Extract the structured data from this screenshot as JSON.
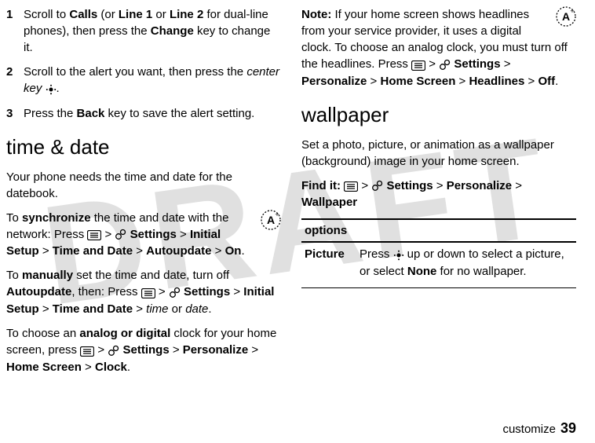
{
  "watermark": "DRAFT",
  "left": {
    "step1_num": "1",
    "step1_a": "Scroll to ",
    "step1_calls": "Calls",
    "step1_b": " (or ",
    "step1_line1": "Line 1",
    "step1_c": " or ",
    "step1_line2": "Line 2",
    "step1_d": " for dual-line phones), then press the ",
    "step1_change": "Change",
    "step1_e": " key to change it.",
    "step2_num": "2",
    "step2_a": "Scroll to the alert you want, then press the ",
    "step2_ck": "center key",
    "step2_b": ".",
    "step3_num": "3",
    "step3_a": "Press the ",
    "step3_back": "Back",
    "step3_b": " key to save the alert setting.",
    "h_timedate": "time & date",
    "td_intro": "Your phone needs the time and date for the datebook.",
    "sync_a": "To ",
    "sync_bold": "synchronize",
    "sync_b": " the time and date with the network: Press ",
    "sync_gt1": " > ",
    "sync_settings": "Settings",
    "sync_gt2": " > ",
    "sync_initial": "Initial Setup",
    "sync_gt3": " > ",
    "sync_td": "Time and Date",
    "sync_gt4": " > ",
    "sync_auto": "Autoupdate",
    "sync_gt5": " > ",
    "sync_on": "On",
    "sync_c": ".",
    "man_a": "To ",
    "man_bold": "manually",
    "man_b": " set the time and date, turn off ",
    "man_auto": "Autoupdate",
    "man_c": ", then: Press ",
    "man_gt1": " > ",
    "man_settings": "Settings",
    "man_gt2": " > ",
    "man_initial": "Initial Setup",
    "man_gt3": " > ",
    "man_td": "Time and Date",
    "man_gt4": " > ",
    "man_time": "time",
    "man_or": " or ",
    "man_date": "date",
    "man_d": ".",
    "clk_a": "To choose an ",
    "clk_bold": "analog or digital",
    "clk_b": " clock for your home screen, press ",
    "clk_gt1": " > ",
    "clk_settings": "Settings",
    "clk_gt2": " > ",
    "clk_pers": "Personalize",
    "clk_gt3": " > ",
    "clk_home": "Home Screen",
    "clk_gt4": " > ",
    "clk_clock": "Clock",
    "clk_c": "."
  },
  "right": {
    "note_label": "Note: ",
    "note_a": "If your home screen shows headlines from your service provider, it uses a digital clock. To choose an analog clock, you must turn off the headlines. Press ",
    "note_gt1": " > ",
    "note_settings": "Settings",
    "note_gt2": " > ",
    "note_pers": "Personalize",
    "note_gt3": " > ",
    "note_home": "Home Screen",
    "note_gt4": " > ",
    "note_headlines": "Headlines",
    "note_gt5": " > ",
    "note_off": "Off",
    "note_b": ".",
    "h_wallpaper": "wallpaper",
    "wp_intro": "Set a photo, picture, or animation as a wallpaper (background) image in your home screen.",
    "find_label": "Find it: ",
    "find_gt1": " > ",
    "find_settings": "Settings",
    "find_gt2": " > ",
    "find_pers": "Personalize",
    "find_gt3": " > ",
    "find_wp": "Wallpaper",
    "options_head": "options",
    "opt_key": "Picture",
    "opt_a": "Press ",
    "opt_b": " up or down to select a picture, or select ",
    "opt_none": "None",
    "opt_c": " for no wallpaper."
  },
  "footer": {
    "section": "customize",
    "page": "39"
  }
}
